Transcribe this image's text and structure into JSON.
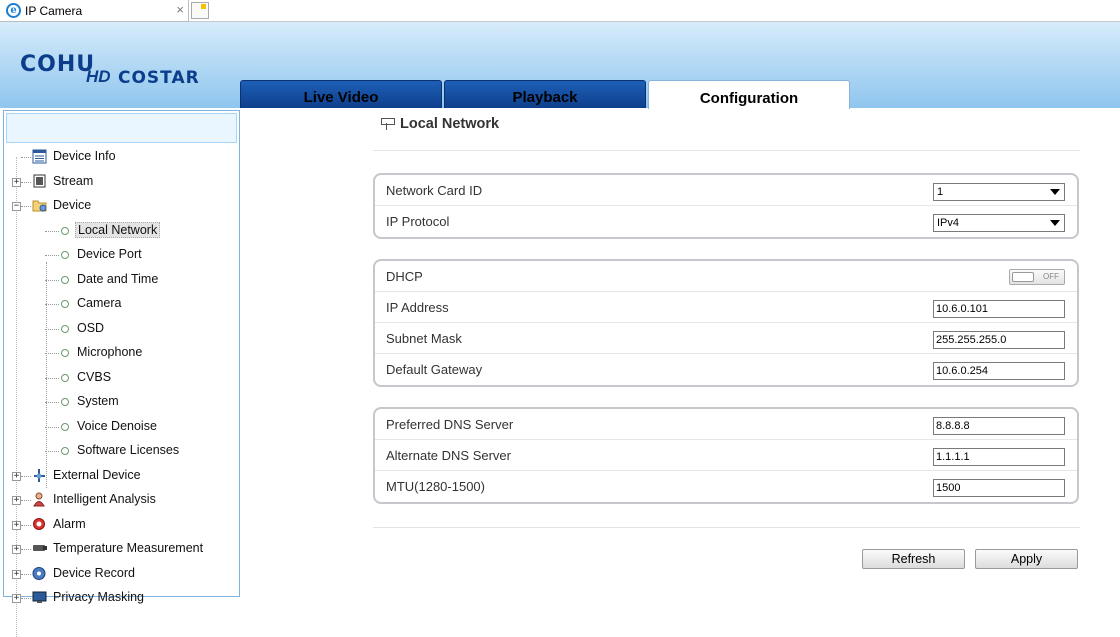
{
  "browser": {
    "tab_title": "IP Camera",
    "close_glyph": "×"
  },
  "logo": {
    "cohu": "COHU",
    "hd": "HD",
    "costar": "COSTAR"
  },
  "tabs": [
    {
      "label": "Live Video",
      "active": false
    },
    {
      "label": "Playback",
      "active": false
    },
    {
      "label": "Configuration",
      "active": true
    }
  ],
  "sidebar": {
    "items": [
      {
        "label": "Device Info",
        "icon": "document-list-icon",
        "expander": ""
      },
      {
        "label": "Stream",
        "icon": "film-icon",
        "expander": "+"
      },
      {
        "label": "Device",
        "icon": "device-folder-icon",
        "expander": "−"
      },
      {
        "label": "External Device",
        "icon": "plug-icon",
        "expander": "+"
      },
      {
        "label": "Intelligent Analysis",
        "icon": "person-icon",
        "expander": "+"
      },
      {
        "label": "Alarm",
        "icon": "alarm-icon",
        "expander": "+"
      },
      {
        "label": "Temperature Measurement",
        "icon": "camera-icon",
        "expander": "+"
      },
      {
        "label": "Device Record",
        "icon": "record-icon",
        "expander": "+"
      },
      {
        "label": "Privacy Masking",
        "icon": "monitor-icon",
        "expander": "+"
      }
    ],
    "device_children": [
      {
        "label": "Local Network",
        "selected": true
      },
      {
        "label": "Device Port",
        "selected": false
      },
      {
        "label": "Date and Time",
        "selected": false
      },
      {
        "label": "Camera",
        "selected": false
      },
      {
        "label": "OSD",
        "selected": false
      },
      {
        "label": "Microphone",
        "selected": false
      },
      {
        "label": "CVBS",
        "selected": false
      },
      {
        "label": "System",
        "selected": false
      },
      {
        "label": "Voice Denoise",
        "selected": false
      },
      {
        "label": "Software Licenses",
        "selected": false
      }
    ]
  },
  "page": {
    "title": "Local Network",
    "title_icon": "network-icon"
  },
  "network": {
    "card_label": "Network Card ID",
    "card_value": "1",
    "protocol_label": "IP Protocol",
    "protocol_value": "IPv4"
  },
  "ip": {
    "dhcp_label": "DHCP",
    "dhcp_state": "OFF",
    "ip_label": "IP Address",
    "ip_value": "10.6.0.101",
    "mask_label": "Subnet Mask",
    "mask_value": "255.255.255.0",
    "gateway_label": "Default Gateway",
    "gateway_value": "10.6.0.254"
  },
  "dns": {
    "preferred_label": "Preferred DNS Server",
    "preferred_value": "8.8.8.8",
    "alternate_label": "Alternate DNS Server",
    "alternate_value": "1.1.1.1",
    "mtu_label": "MTU(1280-1500)",
    "mtu_value": "1500"
  },
  "buttons": {
    "refresh": "Refresh",
    "apply": "Apply"
  }
}
